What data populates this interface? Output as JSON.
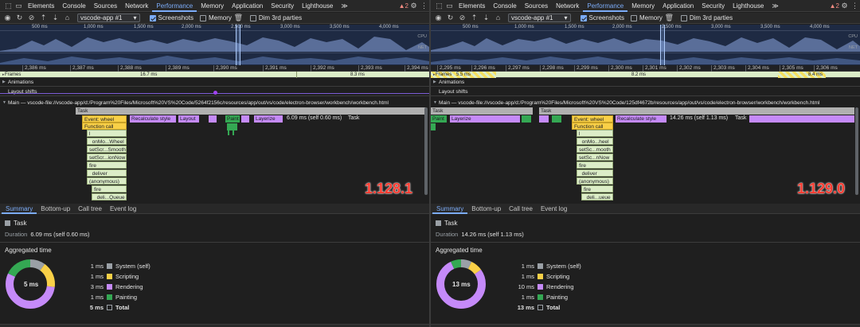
{
  "tabs": [
    "Elements",
    "Console",
    "Sources",
    "Network",
    "Performance",
    "Memory",
    "Application",
    "Security",
    "Lighthouse"
  ],
  "active_tab": "Performance",
  "more": "≫",
  "colors": {
    "accent": "#7cacf8",
    "system": "#9aa0a6",
    "scripting": "#f9d047",
    "rendering": "#c58af9",
    "painting": "#34a853",
    "frames": "#dcedc8",
    "warning": "#f28b82"
  },
  "panes": [
    {
      "warning_count": "2",
      "target": "vscode-app #1",
      "screenshots_label": "Screenshots",
      "memory_label": "Memory",
      "dim_label": "Dim 3rd parties",
      "overview": {
        "ruler": [
          "500 ms",
          "1,000 ms",
          "1,500 ms",
          "2,000 ms",
          "2,500 ms",
          "3,000 ms",
          "3,500 ms",
          "4,000 ms"
        ],
        "cpu": "CPU",
        "net": "NET"
      },
      "ticks": [
        "2,386 ms",
        "2,387 ms",
        "2,388 ms",
        "2,389 ms",
        "2,390 ms",
        "2,391 ms",
        "2,392 ms",
        "2,393 ms",
        "2,394 ms"
      ],
      "frames": {
        "label": "Frames",
        "t1": "16.7 ms",
        "t2": "8.3 ms",
        "t3": ""
      },
      "tracks": {
        "animations": "Animations",
        "layout_shifts": "Layout shifts"
      },
      "main_title": "Main — vscode-file://vscode-app/d:/Program%20Files/Microsoft%20VS%20Code/5264f2156c/resources/app/out/vs/code/electron-browser/workbench/workbench.html",
      "flame": {
        "task_top": "Task",
        "event_wheel": "Event: wheel",
        "recalc": "Recalculate style",
        "layout": "Layout",
        "paint": "Paint",
        "layerize": "Layerize",
        "sel_label": "6.09 ms (self 0.60 ms)",
        "sel_task": "Task",
        "function_call": "Function call",
        "stack": [
          "l",
          "_onMo...Wheel",
          "setScr...Smooth",
          "setScr...ionNow",
          "fire",
          "_deliver",
          "(anonymous)",
          "fire",
          "_deli...Queue"
        ]
      },
      "version": "1.128.1",
      "bottom_tabs": [
        "Summary",
        "Bottom-up",
        "Call tree",
        "Event log"
      ],
      "summary": {
        "title": "Task",
        "duration_label": "Duration",
        "duration_value": "6.09 ms (self 0.60 ms)",
        "aggregated": "Aggregated time",
        "center": "5 ms",
        "rows": [
          {
            "value": "1 ms",
            "label": "System (self)"
          },
          {
            "value": "1 ms",
            "label": "Scripting"
          },
          {
            "value": "3 ms",
            "label": "Rendering"
          },
          {
            "value": "1 ms",
            "label": "Painting"
          },
          {
            "value": "5 ms",
            "label": "Total"
          }
        ],
        "fractions": {
          "system": 0.1,
          "scripting": 0.17,
          "rendering": 0.55,
          "painting": 0.18
        }
      }
    },
    {
      "warning_count": "2",
      "target": "vscode-app #1",
      "screenshots_label": "Screenshots",
      "memory_label": "Memory",
      "dim_label": "Dim 3rd parties",
      "overview": {
        "ruler": [
          "500 ms",
          "1,000 ms",
          "1,500 ms",
          "2,000 ms",
          "2,500 ms",
          "3,000 ms",
          "3,500 ms",
          "4,000 ms"
        ],
        "cpu": "CPU",
        "net": "NET"
      },
      "ticks": [
        "2,295 ms",
        "2,296 ms",
        "2,297 ms",
        "2,298 ms",
        "2,299 ms",
        "2,300 ms",
        "2,301 ms",
        "2,302 ms",
        "2,303 ms",
        "2,304 ms",
        "2,305 ms",
        "2,306 ms"
      ],
      "frames": {
        "label": "Frames",
        "t1": "5.5 ms",
        "t2": "8.2 ms",
        "t3": "8.4 ms"
      },
      "tracks": {
        "animations": "Animations",
        "layout_shifts": "Layout shifts"
      },
      "main_title": "Main — vscode-file://vscode-app/d:/Program%20Files/Microsoft%20VS%20Code/125df4672b/resources/app/out/vs/code/electron-browser/workbench/workbench.html",
      "flame": {
        "task_top": "Task",
        "event_wheel": "Event: wheel",
        "recalc": "Recalculate style",
        "paint": "Paint",
        "layerize": "Layerize",
        "sel_label": "14.26 ms (self 1.13 ms)",
        "sel_task": "Task",
        "function_call": "Function call",
        "stack": [
          "l",
          "_onMo...heel",
          "setSc...mooth",
          "setSc...nNow",
          "fire",
          "_deliver",
          "(anonymous)",
          "fire",
          "_deli...ueue"
        ]
      },
      "version": "1.129.0",
      "bottom_tabs": [
        "Summary",
        "Bottom-up",
        "Call tree",
        "Event log"
      ],
      "summary": {
        "title": "Task",
        "duration_label": "Duration",
        "duration_value": "14.26 ms (self 1.13 ms)",
        "aggregated": "Aggregated time",
        "center": "13 ms",
        "rows": [
          {
            "value": "1 ms",
            "label": "System (self)"
          },
          {
            "value": "1 ms",
            "label": "Scripting"
          },
          {
            "value": "10 ms",
            "label": "Rendering"
          },
          {
            "value": "1 ms",
            "label": "Painting"
          },
          {
            "value": "13 ms",
            "label": "Total"
          }
        ],
        "fractions": {
          "system": 0.07,
          "scripting": 0.08,
          "rendering": 0.78,
          "painting": 0.07
        }
      }
    }
  ]
}
